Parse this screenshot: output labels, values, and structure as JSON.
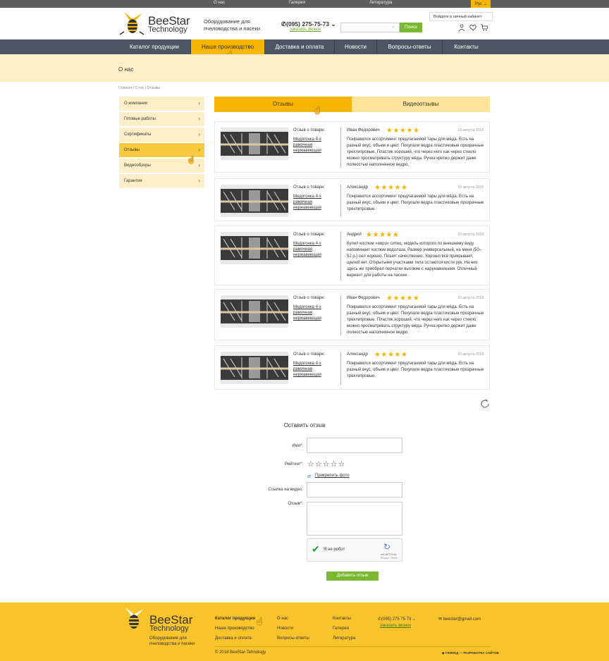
{
  "topbar": {
    "links": [
      "О нас",
      "Галерея",
      "Литература"
    ],
    "lang": "Рус"
  },
  "header": {
    "logo_line1": "BeeStar",
    "logo_line2": "Technology",
    "tagline": "Оборудование для пчеловодства и пасеки",
    "phone": "(095) 275-75-73",
    "callback": "заказать звонок",
    "search_placeholder": "",
    "search_button": "Поиск",
    "tooltip": "Войдите в личный кабинет"
  },
  "nav": [
    "Каталог продукции",
    "Наше производство",
    "Доставка и оплата",
    "Новости",
    "Вопросы-ответы",
    "Контакты"
  ],
  "banner_title": "О нас",
  "breadcrumb": "Главная / О нас / Отзывы",
  "sidebar": [
    "О компании",
    "Готовые работы",
    "Сертификаты",
    "Отзывы",
    "Видеообзоры",
    "Гарантия"
  ],
  "tabs": [
    "Отзывы",
    "Видеоотзывы"
  ],
  "reviews": [
    {
      "label": "Отзыв о товаре:",
      "product": "Медогонка 4-х рамочная нержавеющая",
      "name": "Иван Федорович",
      "rating": 5,
      "date": "10 августа 2018",
      "text": "Понравился ассортимент предлагаемой тары для мёда. Есть на разный вкус, объем и цвет. Покупали ведра пластиковые прозрачные трехлитровые. Пластик хороший, что через него как через стекло можно просматривать структуру мёда. Ручка крепко держит даже полностью наполненное ведро."
    },
    {
      "label": "Отзыв о товаре:",
      "product": "Медогонка 4-х рамочная нержавеющая",
      "name": "Александр",
      "rating": 5,
      "date": "10 августа 2018",
      "text": "Понравился ассортимент предлагаемой тары для мёда. Есть на разный вкус, объем и цвет. Покупали ведра пластиковые прозрачные трехлитровые."
    },
    {
      "label": "Отзыв о товаре:",
      "product": "Медогонка 4-х рамочная нержавеющая",
      "name": "Андрей",
      "rating": 5,
      "date": "10 августа 2018",
      "text": "Купил костюм «евро» ситец, модель которого по внешнему виду напоминает костюм водолаза. Размер универсальный, на меня (50–52 р.) сел хорошо. Пошит качественно. Хорошо всё прикрывает, щелей нет. Открытыми участками тела остаются кисти рук. На них здесь же приобрел перчатки высокие с нарукавниками. Отличный вариант для работы на пасеке."
    },
    {
      "label": "Отзыв о товаре:",
      "product": "Медогонка 4-х рамочная нержавеющая",
      "name": "Иван Федорович",
      "rating": 5,
      "date": "10 августа 2018",
      "text": "Понравился ассортимент предлагаемой тары для мёда. Есть на разный вкус, объем и цвет. Покупали ведра пластиковые прозрачные трехлитровые. Пластик хороший, что через него как через стекло можно просматривать структуру мёда. Ручка крепко держит даже полностью наполненное ведро."
    },
    {
      "label": "Отзыв о товаре:",
      "product": "Медогонка 4-х рамочная нержавеющая",
      "name": "Александр",
      "rating": 5,
      "date": "10 августа 2018",
      "text": "Понравился ассортимент предлагаемой тары для мёда. Есть на разный вкус, объем и цвет. Покупали ведра пластиковые прозрачные трехлитровые."
    }
  ],
  "form": {
    "title": "Оставить отзыв",
    "name_label": "Имя*:",
    "rating_label": "Рейтинг*:",
    "attach": "Прикрепить фото",
    "video_label": "Ссылка на видео:",
    "review_label": "Отзыв*:",
    "captcha": "Я не робот",
    "captcha_brand": "reCAPTCHA",
    "captcha_sub": "Privacy - Terms",
    "submit": "Добавить отзыв"
  },
  "footer": {
    "logo_line1": "BeeStar",
    "logo_line2": "Technology",
    "tagline": "Оборудование для пчеловодства и пасеки",
    "col1": [
      "Каталог продукции",
      "Наше производство",
      "Доставка и оплата"
    ],
    "col2": [
      "О нас",
      "Новости",
      "Вопросы-ответы"
    ],
    "col3": [
      "Контакты",
      "Галерея",
      "Литература"
    ],
    "phone": "(095) 275 75 73",
    "callback": "заказать звонок",
    "email": "beestar@gmail.com",
    "copyright": "© 2018 BeeStar-Tehnology",
    "dev": "ГЛИНОД — РАЗРАБОТКА САЙТОВ"
  },
  "colors": {
    "accent": "#f6b500",
    "nav_bg": "#4b5563",
    "green": "#7ab832",
    "cream": "#fdf0c8"
  }
}
